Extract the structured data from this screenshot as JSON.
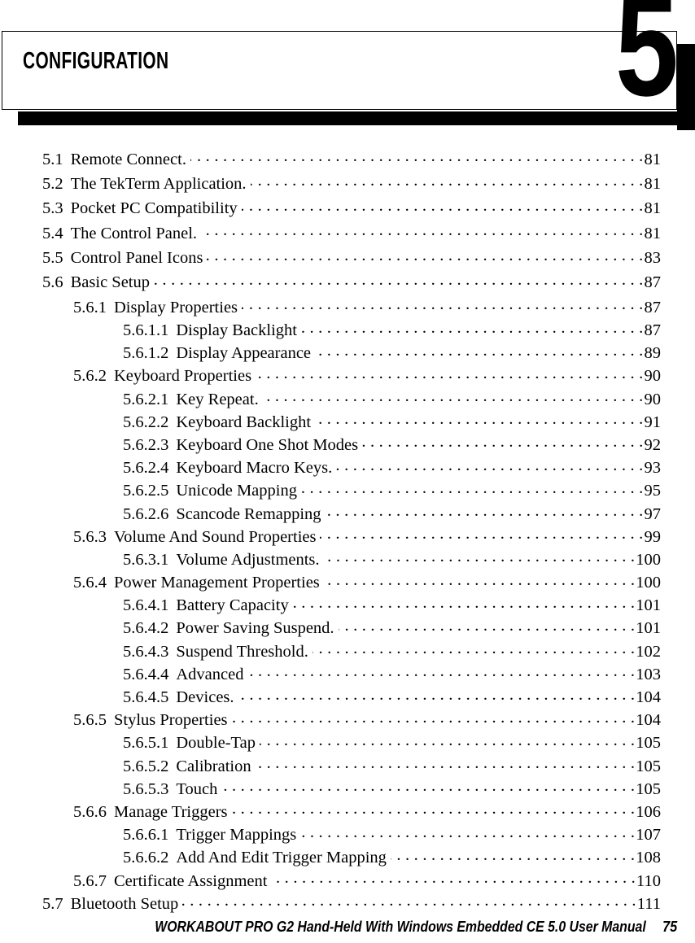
{
  "chapter": {
    "title": "Configuration",
    "number": "5"
  },
  "toc": {
    "entries": [
      {
        "level": 1,
        "number": "5.1",
        "title": "Remote Connect.",
        "page": "81"
      },
      {
        "level": 1,
        "number": "5.2",
        "title": "The TekTerm Application.",
        "page": "81"
      },
      {
        "level": 1,
        "number": "5.3",
        "title": "Pocket PC Compatibility",
        "page": "81"
      },
      {
        "level": 1,
        "number": "5.4",
        "title": "The Control Panel.",
        "page": "81"
      },
      {
        "level": 1,
        "number": "5.5",
        "title": "Control Panel Icons",
        "page": "83"
      },
      {
        "level": 1,
        "number": "5.6",
        "title": "Basic Setup",
        "page": "87"
      },
      {
        "level": 2,
        "number": "5.6.1",
        "title": "Display Properties",
        "page": "87"
      },
      {
        "level": 3,
        "number": "5.6.1.1",
        "title": "Display Backlight",
        "page": "87"
      },
      {
        "level": 3,
        "number": "5.6.1.2",
        "title": "Display Appearance",
        "page": "89"
      },
      {
        "level": 2,
        "number": "5.6.2",
        "title": "Keyboard Properties",
        "page": "90"
      },
      {
        "level": 3,
        "number": "5.6.2.1",
        "title": "Key Repeat.",
        "page": "90"
      },
      {
        "level": 3,
        "number": "5.6.2.2",
        "title": "Keyboard Backlight",
        "page": "91"
      },
      {
        "level": 3,
        "number": "5.6.2.3",
        "title": "Keyboard One Shot Modes",
        "page": "92"
      },
      {
        "level": 3,
        "number": "5.6.2.4",
        "title": "Keyboard Macro Keys.",
        "page": "93"
      },
      {
        "level": 3,
        "number": "5.6.2.5",
        "title": "Unicode Mapping",
        "page": "95"
      },
      {
        "level": 3,
        "number": "5.6.2.6",
        "title": "Scancode Remapping",
        "page": "97"
      },
      {
        "level": 2,
        "number": "5.6.3",
        "title": "Volume And Sound Properties",
        "page": "99"
      },
      {
        "level": 3,
        "number": "5.6.3.1",
        "title": "Volume Adjustments.",
        "page": "100"
      },
      {
        "level": 2,
        "number": "5.6.4",
        "title": "Power Management Properties",
        "page": "100"
      },
      {
        "level": 3,
        "number": "5.6.4.1",
        "title": "Battery Capacity",
        "page": "101"
      },
      {
        "level": 3,
        "number": "5.6.4.2",
        "title": "Power Saving Suspend.",
        "page": "101"
      },
      {
        "level": 3,
        "number": "5.6.4.3",
        "title": "Suspend Threshold.",
        "page": "102"
      },
      {
        "level": 3,
        "number": "5.6.4.4",
        "title": "Advanced",
        "page": "103"
      },
      {
        "level": 3,
        "number": "5.6.4.5",
        "title": "Devices.",
        "page": "104"
      },
      {
        "level": 2,
        "number": "5.6.5",
        "title": "Stylus Properties",
        "page": "104"
      },
      {
        "level": 3,
        "number": "5.6.5.1",
        "title": "Double-Tap",
        "page": "105"
      },
      {
        "level": 3,
        "number": "5.6.5.2",
        "title": "Calibration",
        "page": "105"
      },
      {
        "level": 3,
        "number": "5.6.5.3",
        "title": "Touch",
        "page": "105"
      },
      {
        "level": 2,
        "number": "5.6.6",
        "title": "Manage Triggers",
        "page": "106"
      },
      {
        "level": 3,
        "number": "5.6.6.1",
        "title": "Trigger Mappings",
        "page": "107"
      },
      {
        "level": 3,
        "number": "5.6.6.2",
        "title": "Add And Edit Trigger Mapping",
        "page": "108"
      },
      {
        "level": 2,
        "number": "5.6.7",
        "title": "Certificate Assignment",
        "page": "110"
      },
      {
        "level": 1,
        "number": "5.7",
        "title": "Bluetooth Setup",
        "page": "111"
      }
    ]
  },
  "footer": {
    "text": "WORKABOUT PRO G2 Hand-Held With Windows Embedded CE 5.0 User Manual",
    "page": "75"
  }
}
